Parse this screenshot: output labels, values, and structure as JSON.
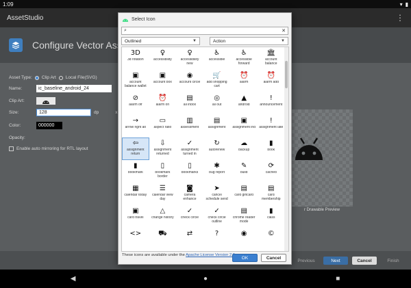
{
  "status_bar": {
    "time": "1:09",
    "icons": [
      "wifi-icon",
      "battery-icon"
    ]
  },
  "app": {
    "title": "AssetStudio",
    "menu_glyph": "⋮"
  },
  "wizard": {
    "title": "Configure Vector Asset"
  },
  "form": {
    "asset_type_label": "Asset Type:",
    "clip_art_option": "Clip Art",
    "local_file_option": "Local File(SVG)",
    "name_label": "Name:",
    "name_value": "ic_baseline_android_24",
    "clip_art_label": "Clip Art:",
    "size_label": "Size:",
    "size_value": "128",
    "size_unit": "dp",
    "size_x": "x",
    "color_label": "Color:",
    "color_value": "000000",
    "opacity_label": "Opacity:",
    "mirror_label": "Enable auto mirroring for RTL layout",
    "preview_label": "r Drawable Preview"
  },
  "footer": {
    "previous": "Previous",
    "next": "Next",
    "cancel": "Cancel",
    "finish": "Finish"
  },
  "dialog": {
    "title": "Select Icon",
    "search_value": "",
    "style_select": "Outlined",
    "category_select": "Action",
    "license_text": "These icons are available under the ",
    "license_link": "Apache License Version 2.0",
    "ok_label": "OK",
    "cancel_label": "Cancel",
    "selected_index": 24,
    "icons": [
      {
        "label": "3d rotation",
        "icon": "3d-rotation-icon",
        "glyph": "3D"
      },
      {
        "label": "accessibility",
        "icon": "accessibility-icon",
        "glyph": "♀"
      },
      {
        "label": "accessibility new",
        "icon": "accessibility-new-icon",
        "glyph": "♀"
      },
      {
        "label": "accessible",
        "icon": "accessible-icon",
        "glyph": "♿"
      },
      {
        "label": "accessible forward",
        "icon": "accessible-forward-icon",
        "glyph": "♿"
      },
      {
        "label": "account balance",
        "icon": "account-balance-icon",
        "glyph": "🏛"
      },
      {
        "label": "account balance wallet",
        "icon": "wallet-icon",
        "glyph": "▣"
      },
      {
        "label": "account box",
        "icon": "account-box-icon",
        "glyph": "▣"
      },
      {
        "label": "account circle",
        "icon": "account-circle-icon",
        "glyph": "◉"
      },
      {
        "label": "add shopping cart",
        "icon": "add-shopping-cart-icon",
        "glyph": "🛒"
      },
      {
        "label": "alarm",
        "icon": "alarm-icon",
        "glyph": "⏰"
      },
      {
        "label": "alarm add",
        "icon": "alarm-add-icon",
        "glyph": "⏰"
      },
      {
        "label": "alarm off",
        "icon": "alarm-off-icon",
        "glyph": "⊘"
      },
      {
        "label": "alarm on",
        "icon": "alarm-on-icon",
        "glyph": "⏰"
      },
      {
        "label": "all inbox",
        "icon": "all-inbox-icon",
        "glyph": "▤"
      },
      {
        "label": "all out",
        "icon": "all-out-icon",
        "glyph": "◎"
      },
      {
        "label": "android",
        "icon": "android-icon",
        "glyph": "▲"
      },
      {
        "label": "announcement",
        "icon": "announcement-icon",
        "glyph": "!"
      },
      {
        "label": "arrow right alt",
        "icon": "arrow-right-alt-icon",
        "glyph": "→"
      },
      {
        "label": "aspect ratio",
        "icon": "aspect-ratio-icon",
        "glyph": "▭"
      },
      {
        "label": "assessment",
        "icon": "assessment-icon",
        "glyph": "▥"
      },
      {
        "label": "assignment",
        "icon": "assignment-icon",
        "glyph": "▤"
      },
      {
        "label": "assignment ind",
        "icon": "assignment-ind-icon",
        "glyph": "▣"
      },
      {
        "label": "assignment late",
        "icon": "assignment-late-icon",
        "glyph": "!"
      },
      {
        "label": "assignment return",
        "icon": "assignment-return-icon",
        "glyph": "⇦"
      },
      {
        "label": "assignment returned",
        "icon": "assignment-returned-icon",
        "glyph": "⇩"
      },
      {
        "label": "assignment turned in",
        "icon": "assignment-turned-in-icon",
        "glyph": "✓"
      },
      {
        "label": "autorenew",
        "icon": "autorenew-icon",
        "glyph": "↻"
      },
      {
        "label": "backup",
        "icon": "backup-icon",
        "glyph": "☁"
      },
      {
        "label": "book",
        "icon": "book-icon",
        "glyph": "▮"
      },
      {
        "label": "bookmark",
        "icon": "bookmark-icon",
        "glyph": "▮"
      },
      {
        "label": "bookmark border",
        "icon": "bookmark-border-icon",
        "glyph": "▯"
      },
      {
        "label": "bookmarks",
        "icon": "bookmarks-icon",
        "glyph": "▯"
      },
      {
        "label": "bug report",
        "icon": "bug-report-icon",
        "glyph": "✱"
      },
      {
        "label": "build",
        "icon": "build-icon",
        "glyph": "✎"
      },
      {
        "label": "cached",
        "icon": "cached-icon",
        "glyph": "⟳"
      },
      {
        "label": "calendar today",
        "icon": "calendar-today-icon",
        "glyph": "▦"
      },
      {
        "label": "calendar view day",
        "icon": "calendar-view-day-icon",
        "glyph": "☰"
      },
      {
        "label": "camera enhance",
        "icon": "camera-enhance-icon",
        "glyph": "◙"
      },
      {
        "label": "cancel schedule send",
        "icon": "cancel-schedule-send-icon",
        "glyph": "➤"
      },
      {
        "label": "card giftcard",
        "icon": "card-giftcard-icon",
        "glyph": "▤"
      },
      {
        "label": "card membership",
        "icon": "card-membership-icon",
        "glyph": "▤"
      },
      {
        "label": "card travel",
        "icon": "card-travel-icon",
        "glyph": "▣"
      },
      {
        "label": "change history",
        "icon": "change-history-icon",
        "glyph": "△"
      },
      {
        "label": "check circle",
        "icon": "check-circle-icon",
        "glyph": "✓"
      },
      {
        "label": "check circle outline",
        "icon": "check-circle-outline-icon",
        "glyph": "✓"
      },
      {
        "label": "chrome reader mode",
        "icon": "chrome-reader-mode-icon",
        "glyph": "▤"
      },
      {
        "label": "class",
        "icon": "class-icon",
        "glyph": "▮"
      },
      {
        "label": "",
        "icon": "code-icon",
        "glyph": "<>"
      },
      {
        "label": "",
        "icon": "commute-icon",
        "glyph": "⛟"
      },
      {
        "label": "",
        "icon": "compare-arrows-icon",
        "glyph": "⇄"
      },
      {
        "label": "",
        "icon": "contact-support-icon",
        "glyph": "?"
      },
      {
        "label": "",
        "icon": "contactless-icon",
        "glyph": "◉"
      },
      {
        "label": "",
        "icon": "copyright-icon",
        "glyph": "©"
      }
    ]
  }
}
